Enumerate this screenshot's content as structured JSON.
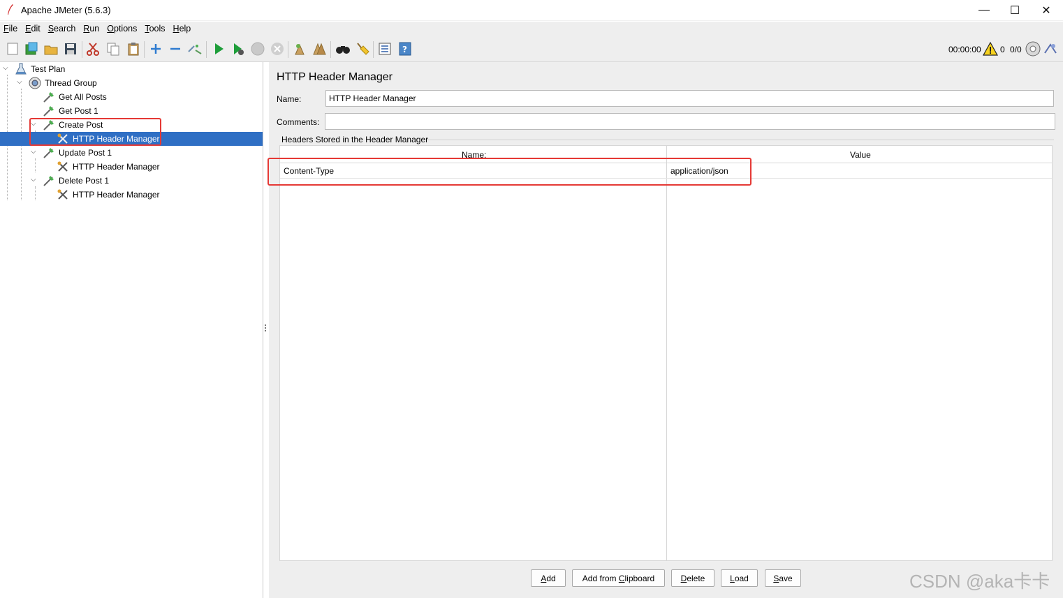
{
  "window": {
    "title": "Apache JMeter (5.6.3)",
    "minimize": "—",
    "maximize": "☐",
    "close": "✕"
  },
  "menu": [
    {
      "label": "File",
      "mnemonic": "F",
      "rest": "ile"
    },
    {
      "label": "Edit",
      "mnemonic": "E",
      "rest": "dit"
    },
    {
      "label": "Search",
      "mnemonic": "S",
      "rest": "earch"
    },
    {
      "label": "Run",
      "mnemonic": "R",
      "rest": "un"
    },
    {
      "label": "Options",
      "mnemonic": "O",
      "rest": "ptions"
    },
    {
      "label": "Tools",
      "mnemonic": "T",
      "rest": "ools"
    },
    {
      "label": "Help",
      "mnemonic": "H",
      "rest": "elp"
    }
  ],
  "toolbar": {
    "icons": [
      "new-icon",
      "templates-icon",
      "open-icon",
      "save-icon",
      "cut-icon",
      "copy-icon",
      "paste-icon",
      "expand-icon",
      "collapse-icon",
      "toggle-icon",
      "start-icon",
      "start-no-pause-icon",
      "stop-icon",
      "shutdown-icon",
      "clear-icon",
      "clear-all-icon",
      "search-icon",
      "reset-search-icon",
      "function-helper-icon",
      "help-icon"
    ],
    "elapsed_time": "00:00:00",
    "error_count": "0",
    "threads": "0/0"
  },
  "tree": {
    "items": [
      {
        "label": "Test Plan",
        "icon": "test-plan-icon"
      },
      {
        "label": "Thread Group",
        "icon": "thread-group-icon"
      },
      {
        "label": "Get All Posts",
        "icon": "http-sampler-icon"
      },
      {
        "label": "Get Post 1",
        "icon": "http-sampler-icon"
      },
      {
        "label": "Create Post",
        "icon": "http-sampler-icon"
      },
      {
        "label": "HTTP Header Manager",
        "icon": "header-manager-icon"
      },
      {
        "label": "Update Post 1",
        "icon": "http-sampler-icon"
      },
      {
        "label": "HTTP Header Manager",
        "icon": "header-manager-icon"
      },
      {
        "label": "Delete Post 1",
        "icon": "http-sampler-icon"
      },
      {
        "label": "HTTP Header Manager",
        "icon": "header-manager-icon"
      }
    ]
  },
  "panel": {
    "title": "HTTP Header Manager",
    "name_label": "Name:",
    "name_value": "HTTP Header Manager",
    "comments_label": "Comments:",
    "comments_value": "",
    "group_title": "Headers Stored in the Header Manager",
    "columns": [
      "Name:",
      "Value"
    ],
    "rows": [
      {
        "name": "Content-Type",
        "value": "application/json"
      }
    ],
    "buttons": [
      {
        "label": "Add",
        "mnemonic": "A",
        "rest": "dd"
      },
      {
        "label": "Add from Clipboard",
        "pre": "Add from ",
        "mnemonic": "C",
        "rest": "lipboard"
      },
      {
        "label": "Delete",
        "mnemonic": "D",
        "rest": "elete"
      },
      {
        "label": "Load",
        "mnemonic": "L",
        "rest": "oad"
      },
      {
        "label": "Save",
        "mnemonic": "S",
        "rest": "ave"
      }
    ]
  },
  "watermark": "CSDN @aka卡卡",
  "colors": {
    "selection": "#2f6fc4",
    "highlight": "#e53935",
    "background": "#eeeeee"
  }
}
